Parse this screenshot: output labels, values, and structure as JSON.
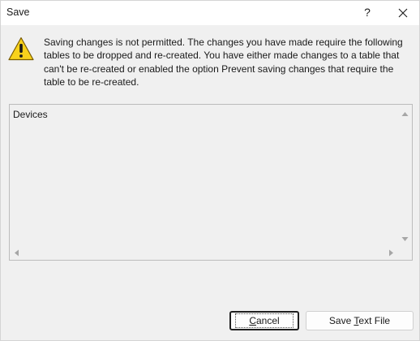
{
  "window": {
    "title": "Save",
    "help_label": "?"
  },
  "message": {
    "icon": "warning-icon",
    "text": "Saving changes is not permitted. The changes you have made require the following tables to be dropped and re-created. You have either made changes to a table that can't be re-created or enabled the option Prevent saving changes that require the table to be re-created."
  },
  "list": {
    "items": [
      "Devices"
    ]
  },
  "buttons": {
    "cancel": {
      "mnemonic": "C",
      "rest": "ancel"
    },
    "save_text_file": {
      "pre": "Save ",
      "mnemonic": "T",
      "rest": "ext File"
    }
  },
  "colors": {
    "warning_yellow": "#f8d21c",
    "warning_outline": "#7a5c00",
    "dialog_background": "#f0f0f0"
  }
}
